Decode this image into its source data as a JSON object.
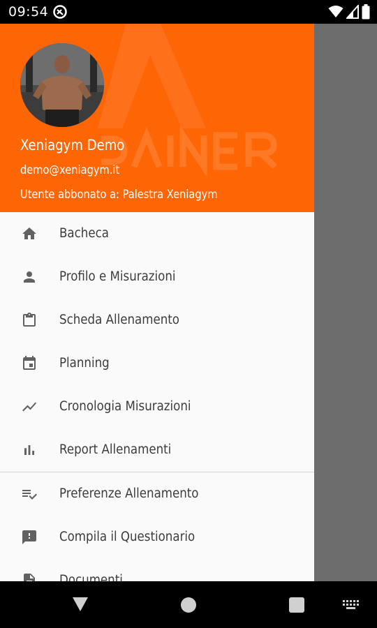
{
  "status_bar": {
    "time": "09:54"
  },
  "drawer": {
    "header": {
      "name": "Xeniagym Demo",
      "email": "demo@xeniagym.it",
      "subscription": "Utente abbonato a: Palestra Xeniagym",
      "brand_color": "#fd6505"
    },
    "items": [
      {
        "label": "Bacheca",
        "icon": "home-icon"
      },
      {
        "label": "Profilo e Misurazioni",
        "icon": "person-icon"
      },
      {
        "label": "Scheda Allenamento",
        "icon": "clipboard-icon"
      },
      {
        "label": "Planning",
        "icon": "calendar-icon"
      },
      {
        "label": "Cronologia Misurazioni",
        "icon": "trending-icon"
      },
      {
        "label": "Report Allenamenti",
        "icon": "bar-chart-icon"
      }
    ],
    "items_secondary": [
      {
        "label": "Preferenze Allenamento",
        "icon": "playlist-check-icon"
      },
      {
        "label": "Compila il Questionario",
        "icon": "feedback-icon"
      },
      {
        "label": "Documenti",
        "icon": "document-icon"
      }
    ]
  }
}
